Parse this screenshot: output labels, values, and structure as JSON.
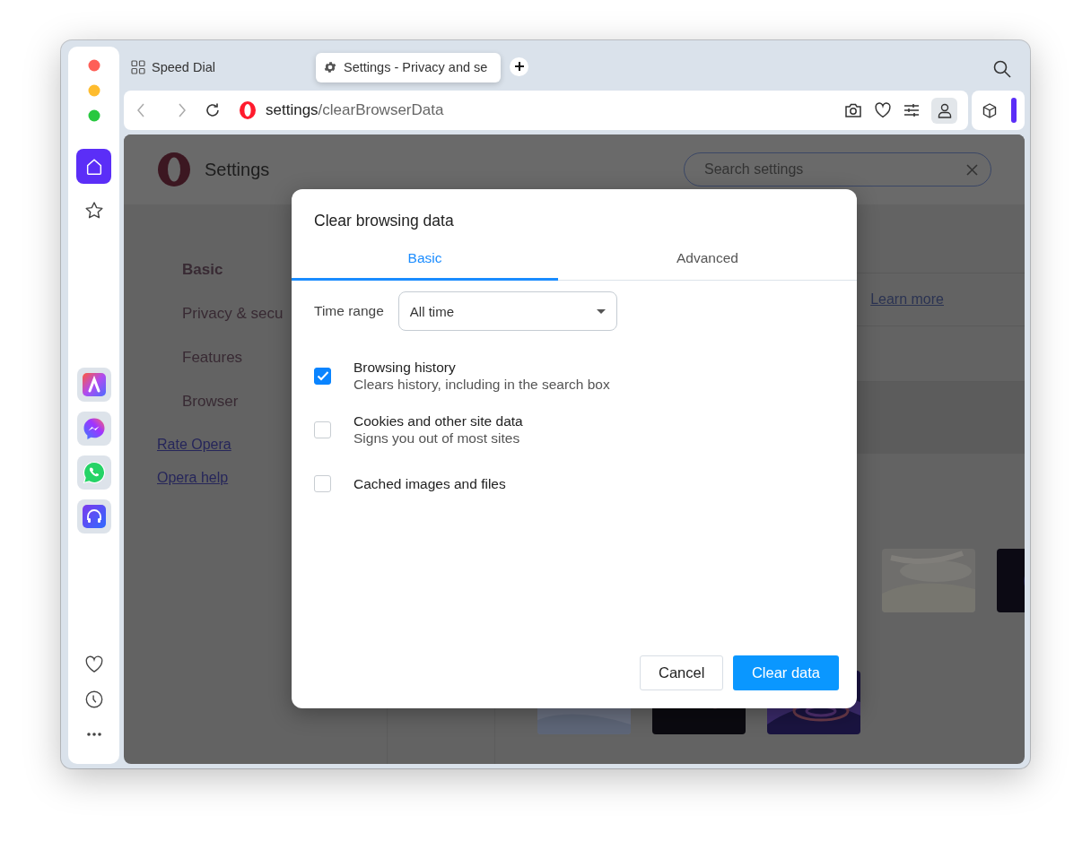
{
  "sidebar": {
    "items": [
      {
        "kind": "home",
        "selected": true
      },
      {
        "kind": "star",
        "selected": false
      }
    ],
    "apps": [
      {
        "kind": "aria"
      },
      {
        "kind": "messenger"
      },
      {
        "kind": "whatsapp"
      },
      {
        "kind": "music"
      }
    ],
    "bottom": [
      {
        "kind": "heart"
      },
      {
        "kind": "history"
      },
      {
        "kind": "more"
      }
    ]
  },
  "tabs": [
    {
      "label": "Speed Dial",
      "kind": "speed-dial",
      "selected": false
    },
    {
      "label": "Settings - Privacy and se",
      "kind": "settings",
      "selected": true
    }
  ],
  "address_bar": {
    "host": "settings",
    "path": "/clearBrowserData"
  },
  "settings_page": {
    "title": "Settings",
    "search": {
      "placeholder": "Search settings"
    },
    "nav": [
      {
        "label": "Basic",
        "selected": true
      },
      {
        "label": "Privacy & secu",
        "selected": false
      },
      {
        "label": "Features",
        "selected": false
      },
      {
        "label": "Browser",
        "selected": false
      }
    ],
    "links": [
      "Rate Opera",
      "Opera help"
    ],
    "learn_more": "Learn more",
    "thumbnails": [
      {
        "kind": "picture"
      },
      {
        "kind": "picture"
      },
      {
        "kind": "picture"
      },
      {
        "kind": "picture"
      },
      {
        "kind": "picture"
      }
    ]
  },
  "dialog": {
    "title": "Clear browsing data",
    "tabs": [
      {
        "label": "Basic",
        "selected": true
      },
      {
        "label": "Advanced",
        "selected": false
      }
    ],
    "time_range": {
      "label": "Time range",
      "value": "All time"
    },
    "options": [
      {
        "label": "Browsing history",
        "description": "Clears history, including in the search box",
        "checked": true
      },
      {
        "label": "Cookies and other site data",
        "description": "Signs you out of most sites",
        "checked": false
      },
      {
        "label": "Cached images and files",
        "checked": false
      }
    ],
    "buttons": [
      {
        "label": "Cancel",
        "kind": "secondary"
      },
      {
        "label": "Clear data",
        "kind": "primary"
      }
    ]
  }
}
